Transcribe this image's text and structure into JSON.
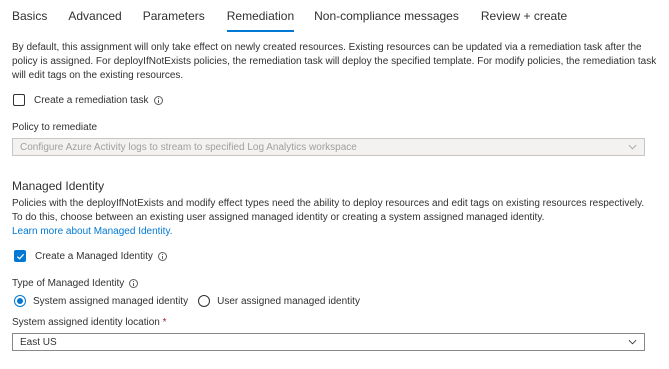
{
  "tabs": [
    {
      "label": "Basics"
    },
    {
      "label": "Advanced"
    },
    {
      "label": "Parameters"
    },
    {
      "label": "Remediation",
      "active": true
    },
    {
      "label": "Non-compliance messages"
    },
    {
      "label": "Review + create"
    }
  ],
  "remediation": {
    "description": "By default, this assignment will only take effect on newly created resources. Existing resources can be updated via a remediation task after the policy is assigned. For deployIfNotExists policies, the remediation task will deploy the specified template. For modify policies, the remediation task will edit tags on the existing resources.",
    "create_task_label": "Create a remediation task",
    "create_task_checked": false,
    "policy_label": "Policy to remediate",
    "policy_value": "Configure Azure Activity logs to stream to specified Log Analytics workspace"
  },
  "identity": {
    "heading": "Managed Identity",
    "description": "Policies with the deployIfNotExists and modify effect types need the ability to deploy resources and edit tags on existing resources respectively. To do this, choose between an existing user assigned managed identity or creating a system assigned managed identity.",
    "learn_more": "Learn more about Managed Identity.",
    "create_label": "Create a Managed Identity",
    "create_checked": true,
    "type_label": "Type of Managed Identity",
    "options": [
      {
        "label": "System assigned managed identity",
        "selected": true
      },
      {
        "label": "User assigned managed identity",
        "selected": false
      }
    ],
    "location_label": "System assigned identity location",
    "location_required_mark": "*",
    "location_value": "East US"
  },
  "colors": {
    "accent": "#0078d4",
    "required": "#a4262c"
  }
}
